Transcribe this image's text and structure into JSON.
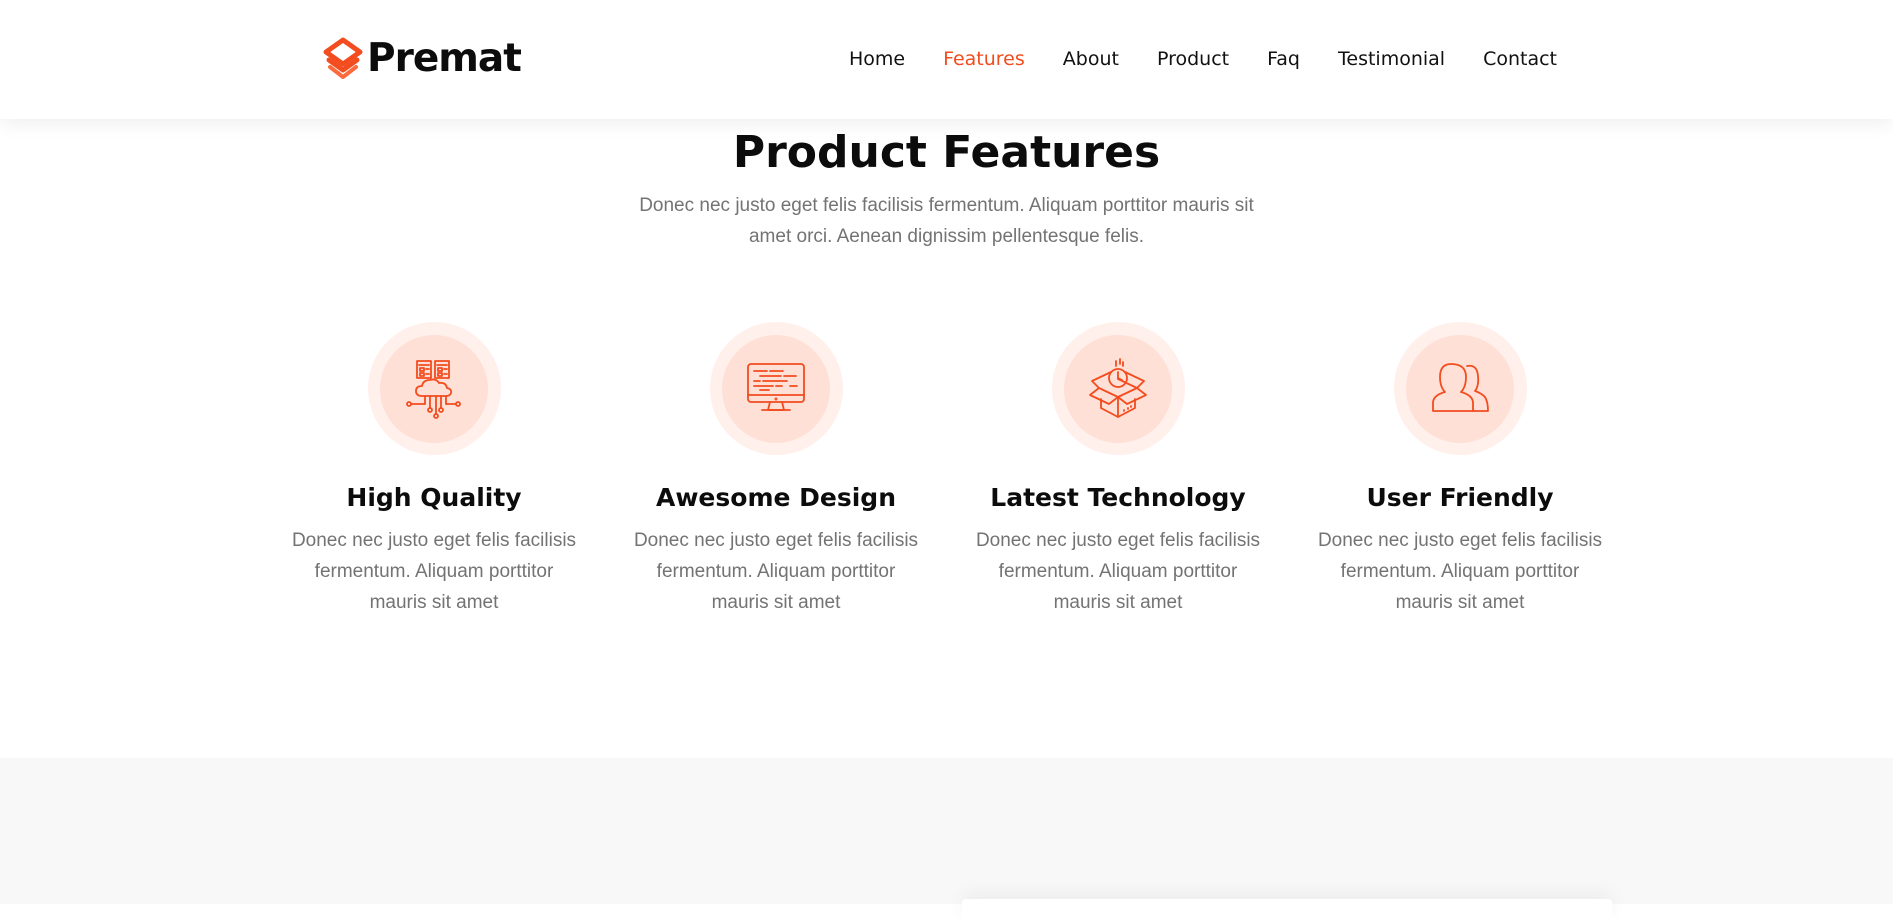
{
  "brand": {
    "name": "Premat",
    "accent_color": "#f24c1f",
    "logo_icon": "stacked-layers-logo-icon"
  },
  "nav": {
    "items": [
      {
        "label": "Home",
        "active": false
      },
      {
        "label": "Features",
        "active": true
      },
      {
        "label": "About",
        "active": false
      },
      {
        "label": "Product",
        "active": false
      },
      {
        "label": "Faq",
        "active": false
      },
      {
        "label": "Testimonial",
        "active": false
      },
      {
        "label": "Contact",
        "active": false
      }
    ]
  },
  "features_section": {
    "title": "Product Features",
    "subtitle": "Donec nec justo eget felis facilisis fermentum. Aliquam porttitor mauris sit amet orci. Aenean dignissim pellentesque felis.",
    "items": [
      {
        "icon": "cloud-server-network-icon",
        "title": "High Quality",
        "description": "Donec nec justo eget felis facilisis fermentum. Aliquam porttitor mauris sit amet"
      },
      {
        "icon": "monitor-code-icon",
        "title": "Awesome Design",
        "description": "Donec nec justo eget felis facilisis fermentum. Aliquam porttitor mauris sit amet"
      },
      {
        "icon": "open-box-timer-icon",
        "title": "Latest Technology",
        "description": "Donec nec justo eget felis facilisis fermentum. Aliquam porttitor mauris sit amet"
      },
      {
        "icon": "users-icon",
        "title": "User Friendly",
        "description": "Donec nec justo eget felis facilisis fermentum. Aliquam porttitor mauris sit amet"
      }
    ]
  },
  "colors": {
    "icon_circle_outer": "#fff0eb",
    "icon_circle_inner": "#ffe0d6",
    "text_muted": "#737373",
    "next_section_bg": "#f8f8f8"
  }
}
